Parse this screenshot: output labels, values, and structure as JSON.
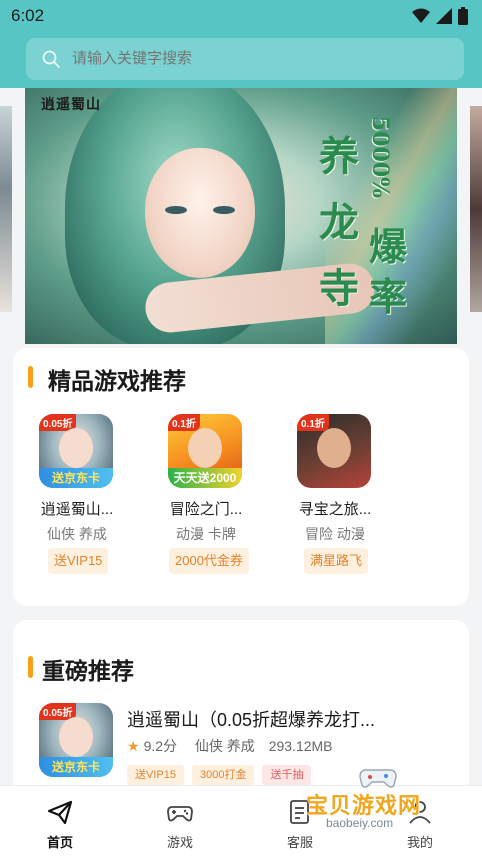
{
  "status_bar": {
    "time": "6:02"
  },
  "search": {
    "placeholder": "请输入关键字搜索"
  },
  "banner": {
    "logo_text": "逍遥蜀山",
    "headline_chars": [
      "养",
      "龙",
      "寺"
    ],
    "headline_side": [
      "5000%",
      "爆",
      "率"
    ]
  },
  "featured": {
    "title": "精品游戏推荐",
    "games": [
      {
        "name": "逍遥蜀山...",
        "tags": "仙侠 养成",
        "badge": "送VIP15",
        "ribbon": "0.05折",
        "art_caption": "送京东卡"
      },
      {
        "name": "冒险之门...",
        "tags": "动漫 卡牌",
        "badge": "2000代金券",
        "ribbon": "0.1折",
        "art_caption": "天天送2000"
      },
      {
        "name": "寻宝之旅...",
        "tags": "冒险 动漫",
        "badge": "满星路飞",
        "ribbon": "0.1折",
        "art_caption": ""
      }
    ]
  },
  "highlight": {
    "title": "重磅推荐",
    "game": {
      "name": "逍遥蜀山（0.05折超爆养龙打...",
      "rating": "9.2分",
      "tags": "仙侠 养成",
      "size": "293.12MB",
      "labels": [
        "送VIP15",
        "3000打金",
        "送千抽"
      ],
      "ribbon": "0.05折",
      "art_caption": "送京东卡"
    }
  },
  "bottom_nav": {
    "items": [
      {
        "label": "首页",
        "icon": "paper-plane-icon",
        "active": true
      },
      {
        "label": "游戏",
        "icon": "gamepad-icon",
        "active": false
      },
      {
        "label": "客服",
        "icon": "document-icon",
        "active": false
      },
      {
        "label": "我的",
        "icon": "user-icon",
        "active": false
      }
    ]
  },
  "watermark": {
    "text": "宝贝游戏网",
    "url": "baobeiy.com"
  },
  "colors": {
    "header": "#57c5c4",
    "accent": "#f7a11a",
    "badge_text": "#e4832d",
    "badge_bg": "#fdf0de"
  }
}
